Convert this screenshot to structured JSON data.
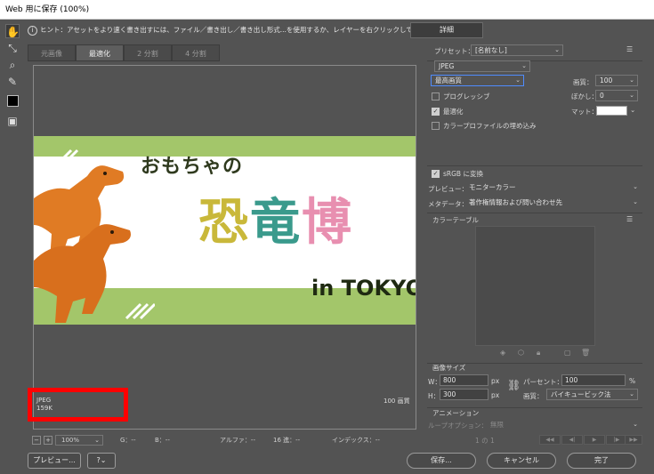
{
  "window": {
    "title": "Web 用に保存 (100%)"
  },
  "hint": {
    "text": "ヒント：アセットをより速く書き出すには、ファイル／書き出し／書き出し形式...を使用するか、レイヤーを右クリックして使用。"
  },
  "detail_button": "詳細",
  "tabs": [
    {
      "label": "元画像"
    },
    {
      "label": "最適化"
    },
    {
      "label": "2 分割"
    },
    {
      "label": "4 分割"
    }
  ],
  "banner": {
    "line1": "おもちゃの",
    "line2": "恐竜博",
    "line3": "in TOKYO",
    "colors": {
      "green": "#a3c66a",
      "yellow": "#c9b83a",
      "teal": "#3a9a8c",
      "pink": "#e88fb0",
      "orange": "#e07b24"
    }
  },
  "preview_status": {
    "format": "JPEG",
    "size": "159K",
    "quality": "100 画質"
  },
  "bottom_bar": {
    "zoom": "100%",
    "g": "G：--",
    "b": "B：--",
    "alpha": "アルファ：--",
    "hex": "16 進：--",
    "index": "インデックス：--"
  },
  "panel": {
    "preset_label": "プリセット：",
    "preset_value": "[名前なし]",
    "format_value": "JPEG",
    "quality_preset": "最高画質",
    "quality_label": "画質：",
    "quality_value": "100",
    "progressive": "プログレッシブ",
    "blur_label": "ぼかし：",
    "blur_value": "0",
    "optimized": "最適化",
    "matte_label": "マット：",
    "embed_profile": "カラープロファイルの埋め込み",
    "srgb": "sRGB に変換",
    "preview_label": "プレビュー：",
    "preview_value": "モニターカラー",
    "metadata_label": "メタデータ：",
    "metadata_value": "著作権情報および問い合わせ先",
    "color_table_title": "カラーテーブル",
    "image_size_title": "画像サイズ",
    "w_label": "W：",
    "w_value": "800",
    "h_label": "H：",
    "h_value": "300",
    "px": "px",
    "percent_label": "パーセント：",
    "percent_value": "100",
    "percent_unit": "%",
    "resample_label": "画質：",
    "resample_value": "バイキュービック法",
    "animation_title": "アニメーション",
    "loop_label": "ループオプション：",
    "loop_value": "無限",
    "frame_counter": "1 の 1"
  },
  "footer": {
    "preview_button": "プレビュー...",
    "save_button": "保存...",
    "cancel_button": "キャンセル",
    "done_button": "完了"
  },
  "colors": {
    "highlight": "#ff0000",
    "focus": "#4f8cff"
  }
}
